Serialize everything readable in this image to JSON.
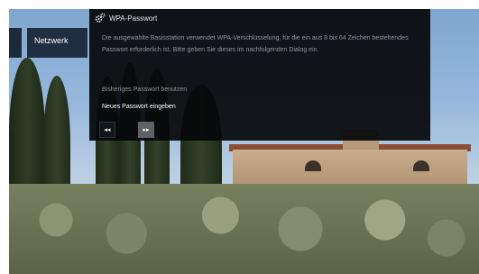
{
  "menu": {
    "item_label": "Netzwerk"
  },
  "dialog": {
    "title": "WPA-Passwort",
    "title_icon": "gear-icon",
    "description": "Die ausgewählte Basisstation verwendet WPA-Verschlüsselung, für die ein aus 8 bis 64 Zeichen bestehendes Passwort erforderlich ist. Bitte geben Sie dieses im nachfolgenden Dialog ein.",
    "options": [
      {
        "label": "Bisheriges Passwort benutzen",
        "selected": false
      },
      {
        "label": "Neues Passwort eingeben",
        "selected": true
      }
    ],
    "nav": {
      "prev_symbol": "◂◂",
      "next_symbol": "▸▸"
    }
  },
  "colors": {
    "dialog_bg": "#06080a",
    "menu_bg": "#1f2e40",
    "next_button": "#5e6166"
  }
}
